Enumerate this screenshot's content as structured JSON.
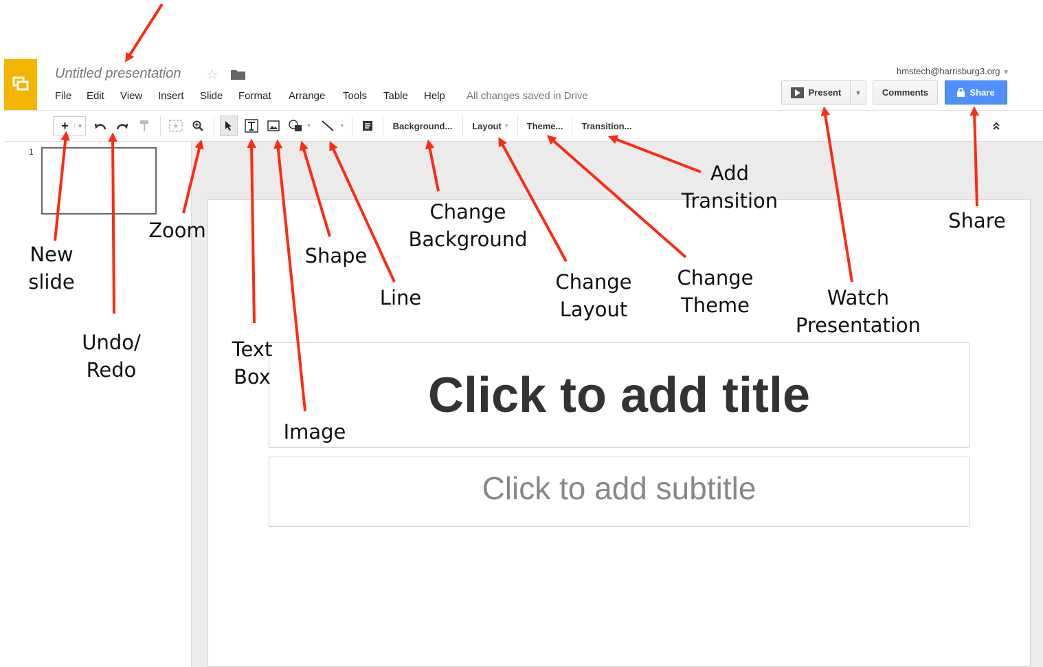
{
  "app": {
    "title": "Untitled presentation",
    "account": "hmstech@harrisburg3.org",
    "save_status": "All changes saved in Drive"
  },
  "menu": [
    "File",
    "Edit",
    "View",
    "Insert",
    "Slide",
    "Format",
    "Arrange",
    "Tools",
    "Table",
    "Help"
  ],
  "buttons": {
    "present": "Present",
    "comments": "Comments",
    "share": "Share"
  },
  "toolbar": {
    "background": "Background...",
    "layout": "Layout",
    "theme": "Theme...",
    "transition": "Transition..."
  },
  "filmstrip": {
    "slide_number": "1"
  },
  "slide": {
    "title_placeholder": "Click to add title",
    "subtitle_placeholder": "Click to add subtitle"
  },
  "annotations": {
    "new_slide": "New\nslide",
    "undo_redo": "Undo/\nRedo",
    "zoom": "Zoom",
    "text_box": "Text\nBox",
    "image": "Image",
    "shape": "Shape",
    "line": "Line",
    "change_background": "Change\nBackground",
    "change_layout": "Change\nLayout",
    "change_theme": "Change\nTheme",
    "add_transition": "Add\nTransition",
    "watch_presentation": "Watch\nPresentation",
    "share": "Share"
  },
  "colors": {
    "logo": "#f4b400",
    "share_button": "#4d90fe",
    "arrow": "#ff2a10"
  }
}
